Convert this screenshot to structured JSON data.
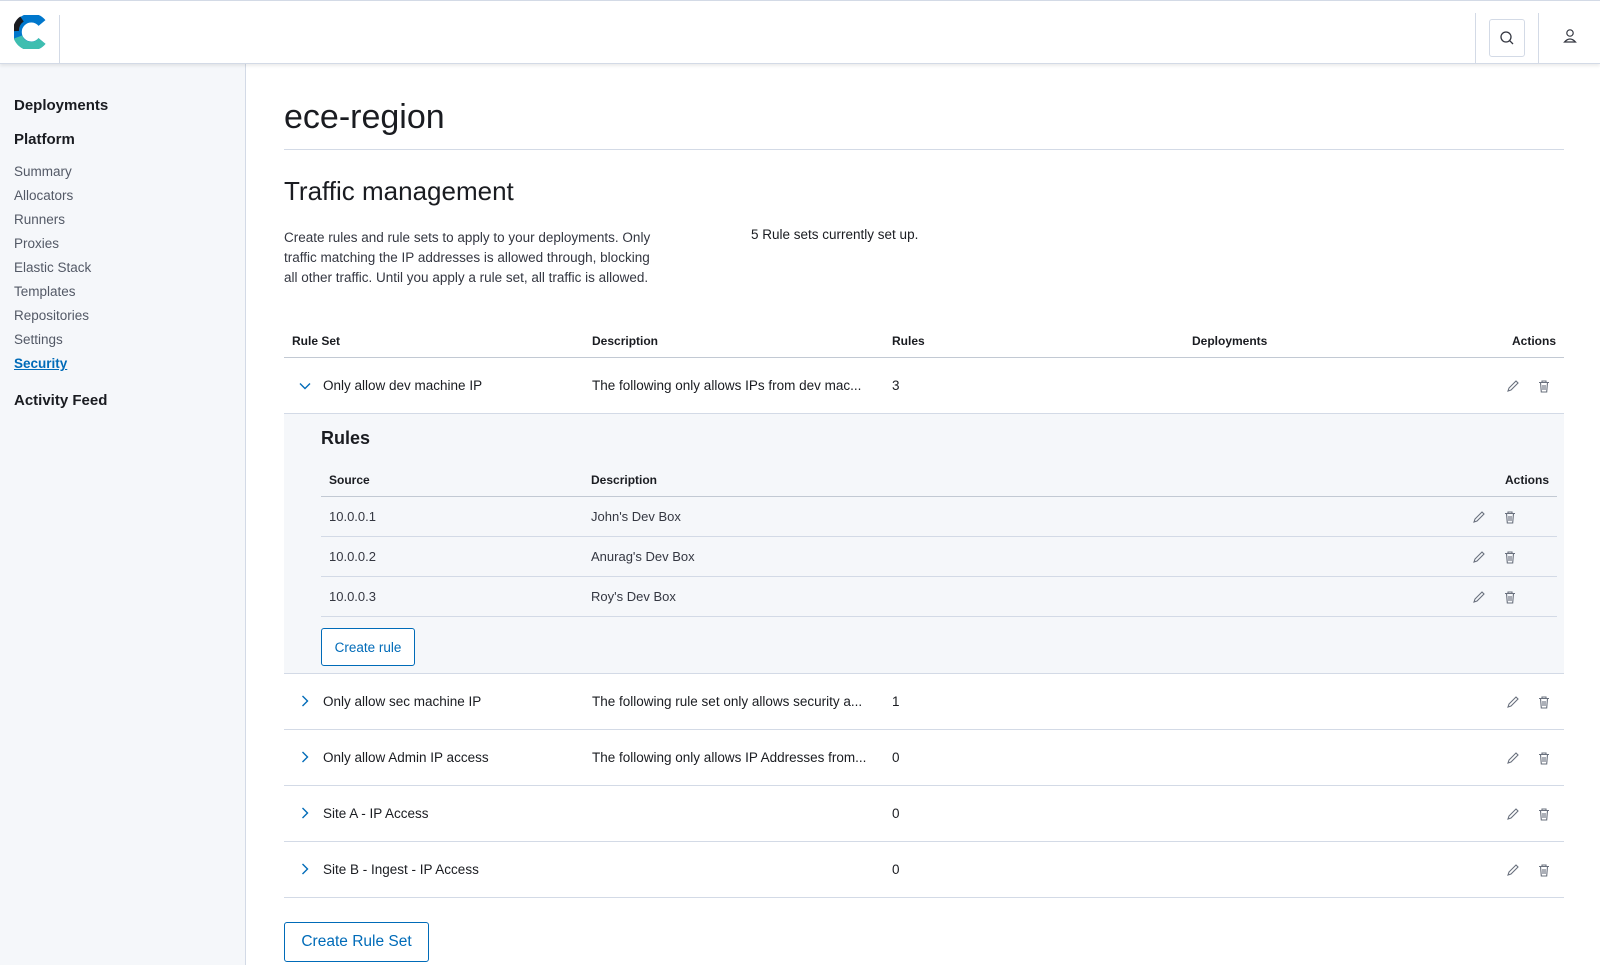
{
  "colors": {
    "accent": "#006bb8",
    "text": "#1a1c21",
    "muted": "#535966",
    "border": "#d3dae6",
    "sidebar_bg": "#f5f7fa"
  },
  "header": {
    "logo_icon": "elastic-cloud-logo-icon",
    "search_icon": "search-icon",
    "user_icon": "user-icon"
  },
  "sidebar": {
    "deployments": "Deployments",
    "platform": "Platform",
    "items": [
      "Summary",
      "Allocators",
      "Runners",
      "Proxies",
      "Elastic Stack",
      "Templates",
      "Repositories",
      "Settings",
      "Security"
    ],
    "active_item": "Security",
    "activity_feed": "Activity Feed"
  },
  "page": {
    "title": "ece-region",
    "section_title": "Traffic management",
    "intro": "Create rules and rule sets to apply to your deployments. Only traffic matching the IP addresses is allowed through, blocking all other traffic. Until you apply a rule set, all traffic is allowed.",
    "count_text": "5 Rule sets currently set up."
  },
  "table": {
    "headers": {
      "rule_set": "Rule Set",
      "description": "Description",
      "rules": "Rules",
      "deployments": "Deployments",
      "actions": "Actions"
    },
    "rows": [
      {
        "name": "Only allow dev machine IP",
        "description": "The following only allows IPs from dev mac...",
        "rules": "3",
        "expanded": true
      },
      {
        "name": "Only allow sec machine IP",
        "description": "The following rule set only allows security a...",
        "rules": "1",
        "expanded": false
      },
      {
        "name": "Only allow Admin IP access",
        "description": "The following only allows IP Addresses from...",
        "rules": "0",
        "expanded": false
      },
      {
        "name": "Site A - IP Access",
        "description": "",
        "rules": "0",
        "expanded": false
      },
      {
        "name": "Site B - Ingest - IP Access",
        "description": "",
        "rules": "0",
        "expanded": false
      }
    ]
  },
  "rules_panel": {
    "title": "Rules",
    "headers": {
      "source": "Source",
      "description": "Description",
      "actions": "Actions"
    },
    "rows": [
      {
        "source": "10.0.0.1",
        "description": "John's Dev Box"
      },
      {
        "source": "10.0.0.2",
        "description": "Anurag's Dev Box"
      },
      {
        "source": "10.0.0.3",
        "description": "Roy's Dev Box"
      }
    ],
    "create_rule_label": "Create rule"
  },
  "create_rule_set_label": "Create Rule Set"
}
